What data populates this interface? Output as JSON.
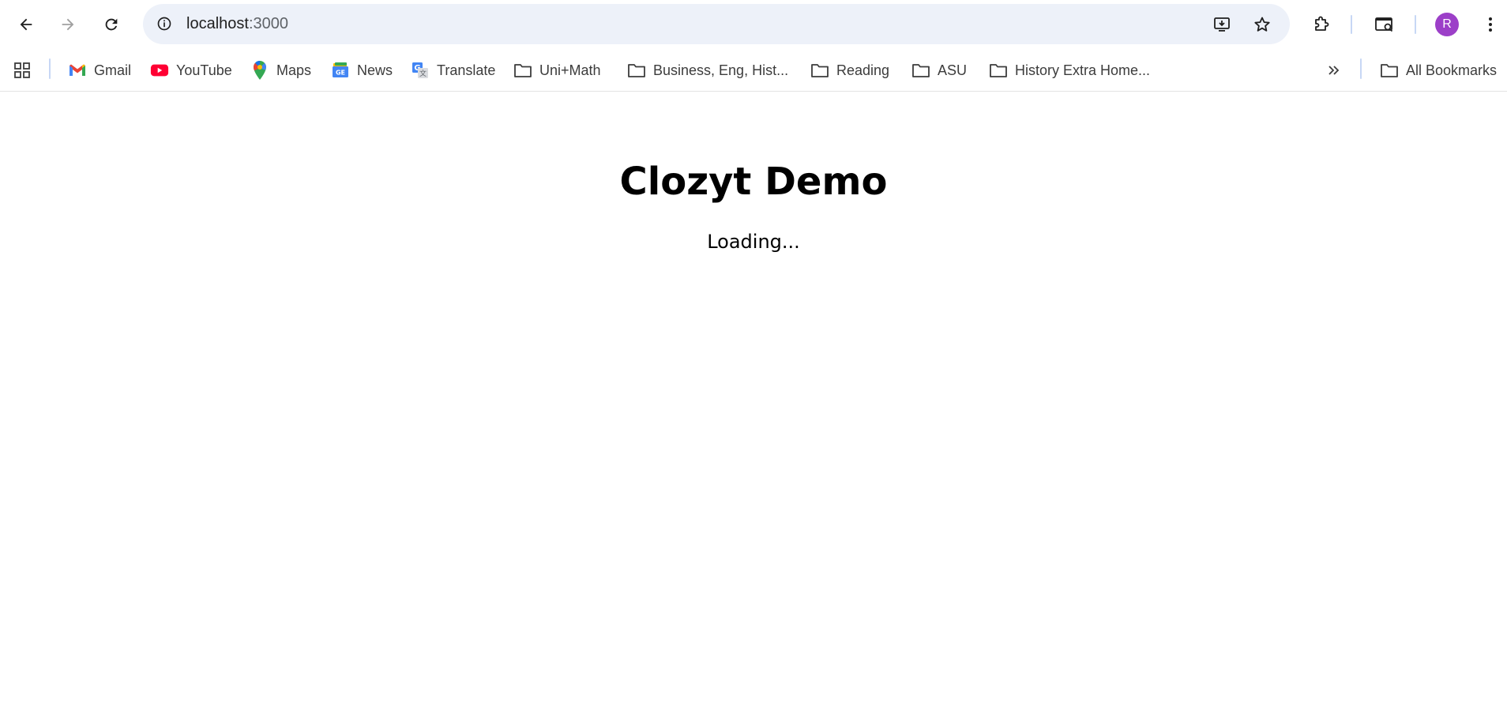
{
  "browser": {
    "address_bar": {
      "host": "localhost",
      "port": ":3000"
    },
    "profile_initial": "R",
    "icons": {
      "back": "arrow-left-icon",
      "forward": "arrow-right-icon",
      "reload": "reload-icon",
      "site_info": "info-circle-icon",
      "install": "install-app-icon",
      "bookmark_star": "star-icon",
      "extensions": "puzzle-icon",
      "tab_search": "tab-search-icon",
      "menu": "kebab-menu-icon"
    },
    "colors": {
      "omnibox_bg": "#edf1f9",
      "avatar_bg": "#9c3fc8"
    }
  },
  "bookmarks": {
    "items": [
      {
        "label": "Gmail",
        "icon": "gmail-icon"
      },
      {
        "label": "YouTube",
        "icon": "youtube-icon"
      },
      {
        "label": "Maps",
        "icon": "maps-icon"
      },
      {
        "label": "News",
        "icon": "news-icon"
      },
      {
        "label": "Translate",
        "icon": "translate-icon"
      },
      {
        "label": "Uni+Math",
        "icon": "folder-icon"
      },
      {
        "label": "Business, Eng, Hist...",
        "icon": "folder-icon"
      },
      {
        "label": "Reading",
        "icon": "folder-icon"
      },
      {
        "label": "ASU",
        "icon": "folder-icon"
      },
      {
        "label": "History Extra Home...",
        "icon": "folder-icon"
      }
    ],
    "all_bookmarks": "All Bookmarks"
  },
  "page": {
    "title": "Clozyt Demo",
    "status": "Loading..."
  }
}
